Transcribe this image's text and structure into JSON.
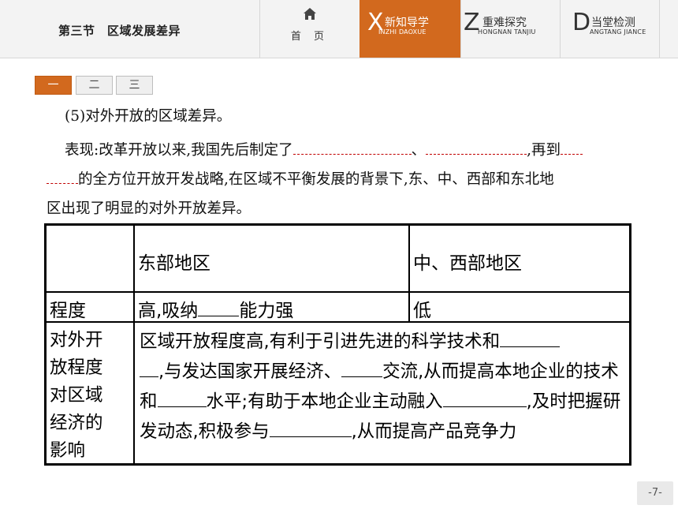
{
  "header": {
    "section_title": "第三节　区域发展差异",
    "home_label": "首 页",
    "tabs": [
      {
        "letter": "X",
        "cn": "新知导学",
        "en": "INZHI DAOXUE",
        "active": true
      },
      {
        "letter": "Z",
        "cn": "重难探究",
        "en": "HONGNAN TANJIU",
        "active": false
      },
      {
        "letter": "D",
        "cn": "当堂检测",
        "en": "ANGTANG JIANCE",
        "active": false
      }
    ]
  },
  "subtabs": [
    "一",
    "二",
    "三"
  ],
  "body": {
    "line1": "(5)对外开放的区域差异。",
    "line2_a": "表现:改革开放以来,我国先后制定了",
    "line2_b": "、",
    "line2_c": ",再到",
    "line3_a": "的全方位开放开发战略,在区域不平衡发展的背景下,东、中、西部和东北地",
    "line4": "区出现了明显的对外开放差异。"
  },
  "table": {
    "col_east": "东部地区",
    "col_midwest": "中、西部地区",
    "row1_label": "程度",
    "row1_east_a": "高,吸纳",
    "row1_east_b": "能力强",
    "row1_midwest": "低",
    "row2_label": [
      "对外开",
      "放程度",
      "对区域",
      "经济的",
      "影响"
    ],
    "row2_text": {
      "a": "区域开放程度高,有利于引进先进的科学技术和",
      "b": ",与发达国家开展经济、",
      "c": "交流,从而提高本地企业的技术和",
      "d": "水平;有助于本地企业主动融入",
      "e": ",及时把握研发动态,积极参与",
      "f": ",从而提高产品竞争力"
    }
  },
  "footer": {
    "page": "-7-"
  },
  "colors": {
    "accent": "#d2691e",
    "answer_red": "#c00000"
  }
}
